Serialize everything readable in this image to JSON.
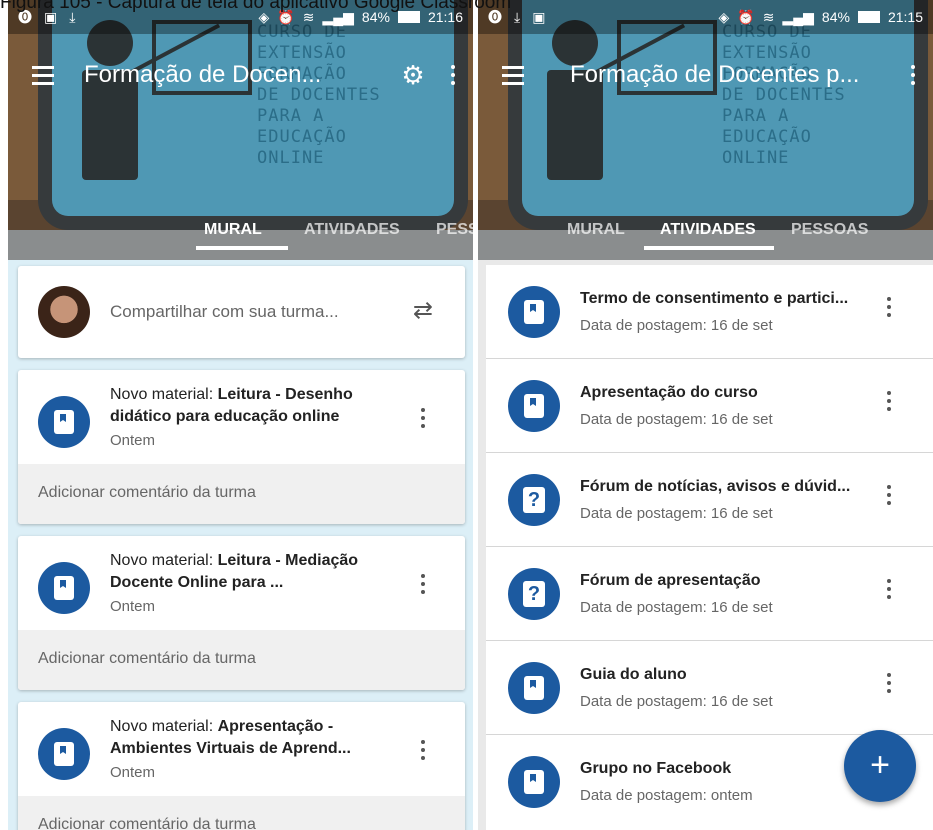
{
  "caption": "Figura 105 - Captura de tela do aplicativo Google Classroom",
  "board_text": "CURSO DE\nEXTENSÃO\nFORMAÇÃO\nDE DOCENTES\nPARA A\nEDUCAÇÃO\nONLINE",
  "colors": {
    "accent": "#1c5aa0",
    "board": "#4f98b4",
    "bg": "#dceff7"
  },
  "screen1": {
    "status": {
      "battery": "84%",
      "time": "21:16"
    },
    "title": "Formação de Docen...",
    "tabs": [
      "MURAL",
      "ATIVIDADES",
      "PESS"
    ],
    "active_tab": "MURAL",
    "share_placeholder": "Compartilhar com sua turma...",
    "posts": [
      {
        "prefix": "Novo material: ",
        "title": "Leitura - Desenho didático para educação online",
        "time": "Ontem",
        "comment": "Adicionar comentário da turma"
      },
      {
        "prefix": "Novo material: ",
        "title": "Leitura - Mediação Docente Online para ...",
        "time": "Ontem",
        "comment": "Adicionar comentário da turma"
      },
      {
        "prefix": "Novo material: ",
        "title": "Apresentação - Ambientes Virtuais de Aprend...",
        "time": "Ontem",
        "comment": "Adicionar comentário da turma"
      }
    ]
  },
  "screen2": {
    "status": {
      "battery": "84%",
      "time": "21:15"
    },
    "title": "Formação de Docentes p...",
    "tabs": [
      "MURAL",
      "ATIVIDADES",
      "PESSOAS"
    ],
    "active_tab": "ATIVIDADES",
    "items": [
      {
        "icon": "material",
        "title": "Termo de consentimento e partici...",
        "sub": "Data de postagem: 16 de set"
      },
      {
        "icon": "material",
        "title": "Apresentação do curso",
        "sub": "Data de postagem: 16 de set"
      },
      {
        "icon": "question",
        "title": "Fórum de notícias, avisos e dúvid...",
        "sub": "Data de postagem: 16 de set"
      },
      {
        "icon": "question",
        "title": "Fórum de apresentação",
        "sub": "Data de postagem: 16 de set"
      },
      {
        "icon": "material",
        "title": "Guia do aluno",
        "sub": "Data de postagem: 16 de set"
      },
      {
        "icon": "material",
        "title": "Grupo no Facebook",
        "sub": "Data de postagem: ontem"
      }
    ],
    "fab": "+"
  }
}
